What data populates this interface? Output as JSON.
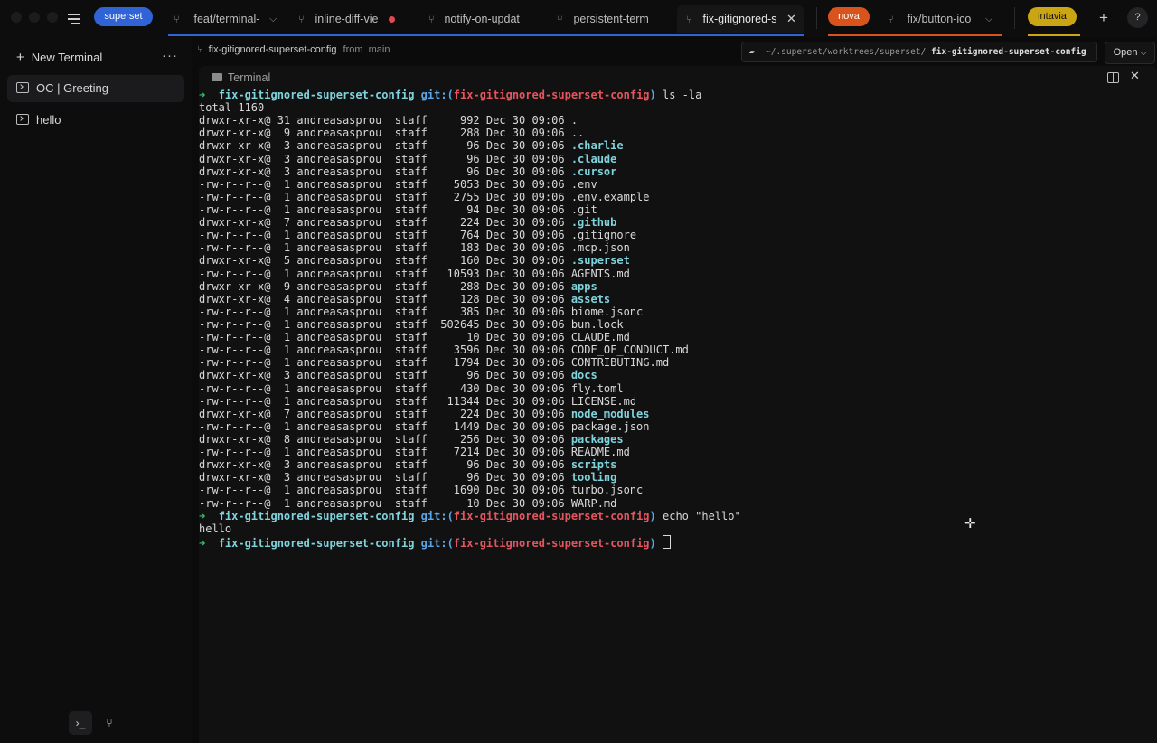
{
  "topbar": {
    "workspaces": [
      {
        "label": "superset",
        "color": "#2f63d6"
      },
      {
        "label": "nova",
        "color": "#d9541c"
      },
      {
        "label": "intavia",
        "color": "#caa514"
      }
    ],
    "tabs": [
      {
        "label": "feat/terminal-",
        "workspace": "superset"
      },
      {
        "label": "inline-diff-vie",
        "workspace": "superset",
        "status": "unsaved"
      },
      {
        "label": "notify-on-updat",
        "workspace": "superset"
      },
      {
        "label": "persistent-term",
        "workspace": "superset"
      },
      {
        "label": "fix-gitignored-s",
        "workspace": "superset",
        "active": true
      },
      {
        "label": "fix/button-ico",
        "workspace": "nova"
      }
    ],
    "icons": [
      "menu-icon",
      "plus-icon",
      "help-icon"
    ],
    "help_label": "?"
  },
  "sidebar": {
    "new_terminal": "New Terminal",
    "more": "···",
    "items": [
      {
        "label": "OC | Greeting",
        "selected": true
      },
      {
        "label": "hello",
        "selected": false
      }
    ],
    "bottom": {
      "terminal": "›_",
      "branch": "⑂"
    }
  },
  "breadcrumb": {
    "branch": "fix-gitignored-superset-config",
    "from_label": "from",
    "base": "main"
  },
  "path": {
    "prefix": "~/.superset/worktrees/superset/",
    "name": "fix-gitignored-superset-config"
  },
  "open_button": "Open",
  "pane": {
    "title": "Terminal"
  },
  "terminal": {
    "prompt": {
      "branch": "fix-gitignored-superset-config",
      "git": "git:(",
      "git_branch": "fix-gitignored-superset-config",
      "git_close": ")"
    },
    "commands": [
      "ls -la",
      "echo \"hello\""
    ],
    "total": "total 1160",
    "listing": [
      [
        "drwxr-xr-x@",
        "31",
        "andreasasprou",
        "staff",
        "992",
        "Dec 30 09:06",
        ".",
        false
      ],
      [
        "drwxr-xr-x@",
        "9",
        "andreasasprou",
        "staff",
        "288",
        "Dec 30 09:06",
        "..",
        false
      ],
      [
        "drwxr-xr-x@",
        "3",
        "andreasasprou",
        "staff",
        "96",
        "Dec 30 09:06",
        ".charlie",
        true
      ],
      [
        "drwxr-xr-x@",
        "3",
        "andreasasprou",
        "staff",
        "96",
        "Dec 30 09:06",
        ".claude",
        true
      ],
      [
        "drwxr-xr-x@",
        "3",
        "andreasasprou",
        "staff",
        "96",
        "Dec 30 09:06",
        ".cursor",
        true
      ],
      [
        "-rw-r--r--@",
        "1",
        "andreasasprou",
        "staff",
        "5053",
        "Dec 30 09:06",
        ".env",
        false
      ],
      [
        "-rw-r--r--@",
        "1",
        "andreasasprou",
        "staff",
        "2755",
        "Dec 30 09:06",
        ".env.example",
        false
      ],
      [
        "-rw-r--r--@",
        "1",
        "andreasasprou",
        "staff",
        "94",
        "Dec 30 09:06",
        ".git",
        false
      ],
      [
        "drwxr-xr-x@",
        "7",
        "andreasasprou",
        "staff",
        "224",
        "Dec 30 09:06",
        ".github",
        true
      ],
      [
        "-rw-r--r--@",
        "1",
        "andreasasprou",
        "staff",
        "764",
        "Dec 30 09:06",
        ".gitignore",
        false
      ],
      [
        "-rw-r--r--@",
        "1",
        "andreasasprou",
        "staff",
        "183",
        "Dec 30 09:06",
        ".mcp.json",
        false
      ],
      [
        "drwxr-xr-x@",
        "5",
        "andreasasprou",
        "staff",
        "160",
        "Dec 30 09:06",
        ".superset",
        true
      ],
      [
        "-rw-r--r--@",
        "1",
        "andreasasprou",
        "staff",
        "10593",
        "Dec 30 09:06",
        "AGENTS.md",
        false
      ],
      [
        "drwxr-xr-x@",
        "9",
        "andreasasprou",
        "staff",
        "288",
        "Dec 30 09:06",
        "apps",
        true
      ],
      [
        "drwxr-xr-x@",
        "4",
        "andreasasprou",
        "staff",
        "128",
        "Dec 30 09:06",
        "assets",
        true
      ],
      [
        "-rw-r--r--@",
        "1",
        "andreasasprou",
        "staff",
        "385",
        "Dec 30 09:06",
        "biome.jsonc",
        false
      ],
      [
        "-rw-r--r--@",
        "1",
        "andreasasprou",
        "staff",
        "502645",
        "Dec 30 09:06",
        "bun.lock",
        false
      ],
      [
        "-rw-r--r--@",
        "1",
        "andreasasprou",
        "staff",
        "10",
        "Dec 30 09:06",
        "CLAUDE.md",
        false
      ],
      [
        "-rw-r--r--@",
        "1",
        "andreasasprou",
        "staff",
        "3596",
        "Dec 30 09:06",
        "CODE_OF_CONDUCT.md",
        false
      ],
      [
        "-rw-r--r--@",
        "1",
        "andreasasprou",
        "staff",
        "1794",
        "Dec 30 09:06",
        "CONTRIBUTING.md",
        false
      ],
      [
        "drwxr-xr-x@",
        "3",
        "andreasasprou",
        "staff",
        "96",
        "Dec 30 09:06",
        "docs",
        true
      ],
      [
        "-rw-r--r--@",
        "1",
        "andreasasprou",
        "staff",
        "430",
        "Dec 30 09:06",
        "fly.toml",
        false
      ],
      [
        "-rw-r--r--@",
        "1",
        "andreasasprou",
        "staff",
        "11344",
        "Dec 30 09:06",
        "LICENSE.md",
        false
      ],
      [
        "drwxr-xr-x@",
        "7",
        "andreasasprou",
        "staff",
        "224",
        "Dec 30 09:06",
        "node_modules",
        true
      ],
      [
        "-rw-r--r--@",
        "1",
        "andreasasprou",
        "staff",
        "1449",
        "Dec 30 09:06",
        "package.json",
        false
      ],
      [
        "drwxr-xr-x@",
        "8",
        "andreasasprou",
        "staff",
        "256",
        "Dec 30 09:06",
        "packages",
        true
      ],
      [
        "-rw-r--r--@",
        "1",
        "andreasasprou",
        "staff",
        "7214",
        "Dec 30 09:06",
        "README.md",
        false
      ],
      [
        "drwxr-xr-x@",
        "3",
        "andreasasprou",
        "staff",
        "96",
        "Dec 30 09:06",
        "scripts",
        true
      ],
      [
        "drwxr-xr-x@",
        "3",
        "andreasasprou",
        "staff",
        "96",
        "Dec 30 09:06",
        "tooling",
        true
      ],
      [
        "-rw-r--r--@",
        "1",
        "andreasasprou",
        "staff",
        "1690",
        "Dec 30 09:06",
        "turbo.jsonc",
        false
      ],
      [
        "-rw-r--r--@",
        "1",
        "andreasasprou",
        "staff",
        "10",
        "Dec 30 09:06",
        "WARP.md",
        false
      ]
    ],
    "echo_output": "hello",
    "prompt_arrow": "➜"
  }
}
